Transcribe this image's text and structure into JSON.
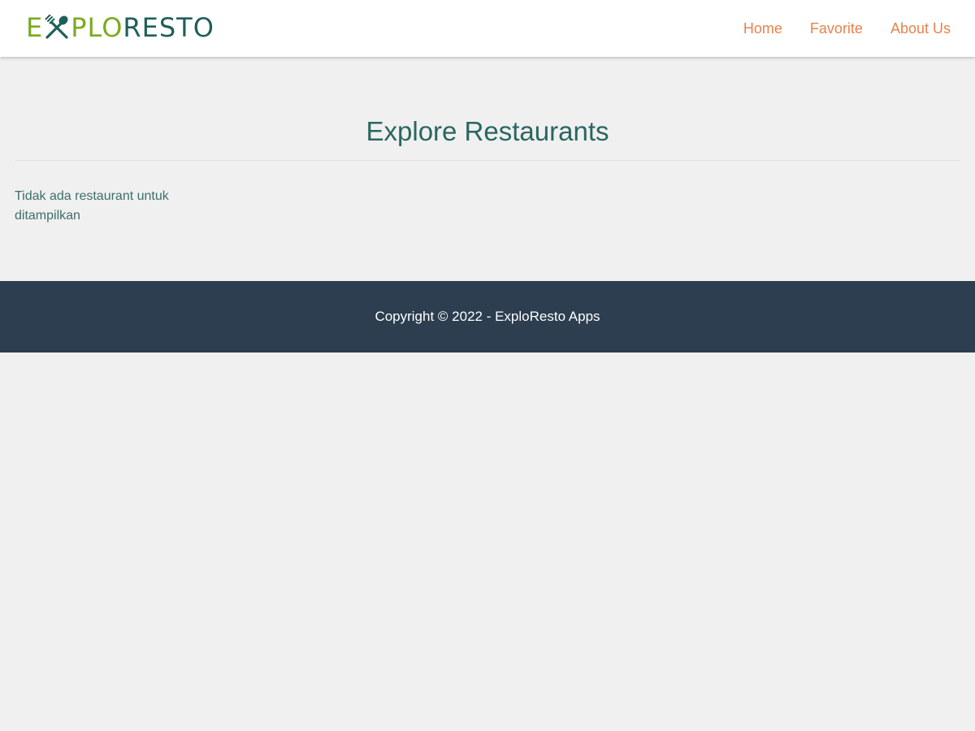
{
  "header": {
    "logo": {
      "text_part1": "E",
      "text_part2": "PLO",
      "text_part3": "RESTO",
      "icon": "fork-spoon-icon",
      "colors": {
        "green": "#7aab1f",
        "teal": "#1f5f5a"
      }
    },
    "nav": [
      {
        "label": "Home"
      },
      {
        "label": "Favorite"
      },
      {
        "label": "About Us"
      }
    ],
    "nav_color": "#e8824a"
  },
  "main": {
    "title": "Explore Restaurants",
    "empty_message": "Tidak ada restaurant untuk ditampilkan"
  },
  "footer": {
    "text": "Copyright © 2022 - ExploResto Apps",
    "background": "#2c3e50"
  }
}
